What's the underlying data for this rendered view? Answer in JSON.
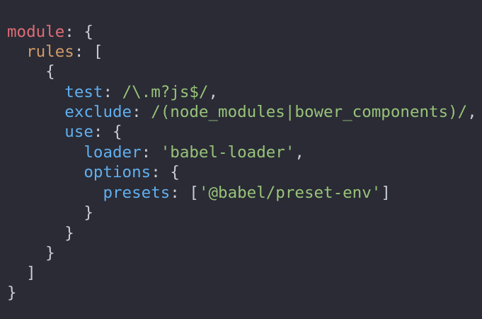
{
  "code": {
    "module_key": "module",
    "rules_key": "rules",
    "test_key": "test",
    "test_value": "/\\.m?js$/",
    "exclude_key": "exclude",
    "exclude_value": "/(node_modules|bower_components)/",
    "use_key": "use",
    "loader_key": "loader",
    "loader_value": "'babel-loader'",
    "options_key": "options",
    "presets_key": "presets",
    "presets_value": "'@babel/preset-env'"
  },
  "colors": {
    "background": "#2a2b35",
    "keyword_red": "#e06c75",
    "property_orange": "#d19a66",
    "property_blue": "#61afef",
    "string_green": "#98c379",
    "punctuation": "#c8ccd4"
  }
}
